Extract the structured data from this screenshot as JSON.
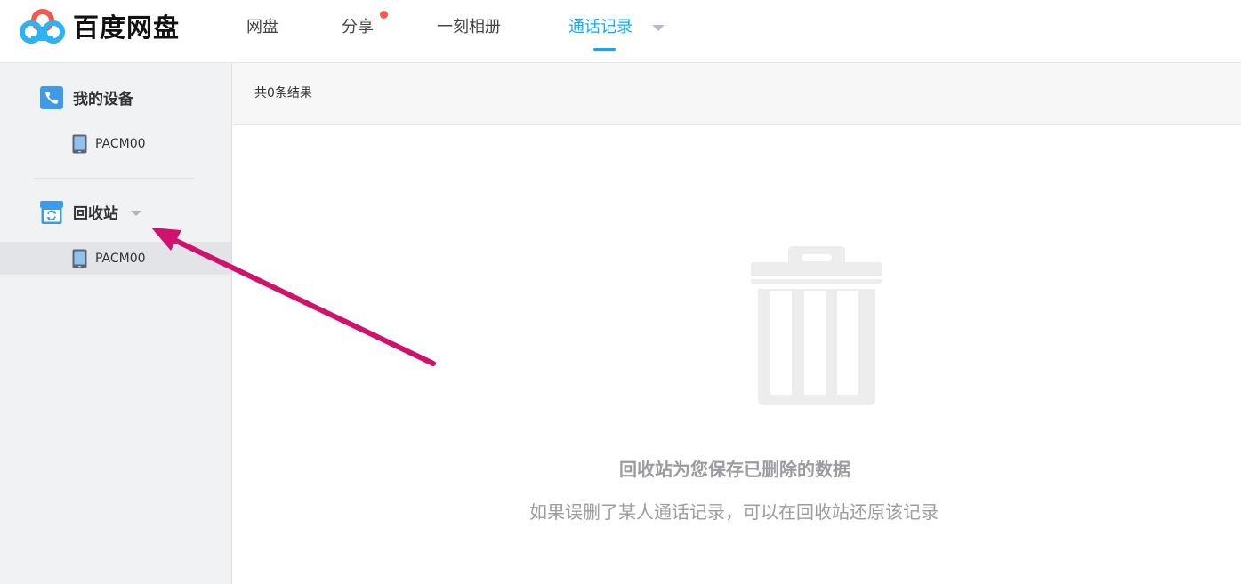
{
  "header": {
    "brand": "百度网盘",
    "nav": [
      "网盘",
      "分享",
      "一刻相册",
      "通话记录"
    ],
    "active_index": 3
  },
  "sidebar": {
    "devices_title": "我的设备",
    "devices": [
      "PACM00"
    ],
    "recycle_title": "回收站",
    "recycle_devices": [
      "PACM00"
    ]
  },
  "main": {
    "result_count": "共0条结果",
    "empty_line1": "回收站为您保存已删除的数据",
    "empty_line2": "如果误删了某人通话记录，可以在回收站还原该记录"
  },
  "colors": {
    "accent": "#09aaff",
    "badge": "#f25c4d",
    "annotation_arrow": "#d0126d"
  },
  "icons": {
    "logo": "baidu-cloud-logo",
    "devices": "phone-icon",
    "device": "mobile-device-icon",
    "recycle": "recycle-bin-icon",
    "empty": "trash-can-icon"
  }
}
